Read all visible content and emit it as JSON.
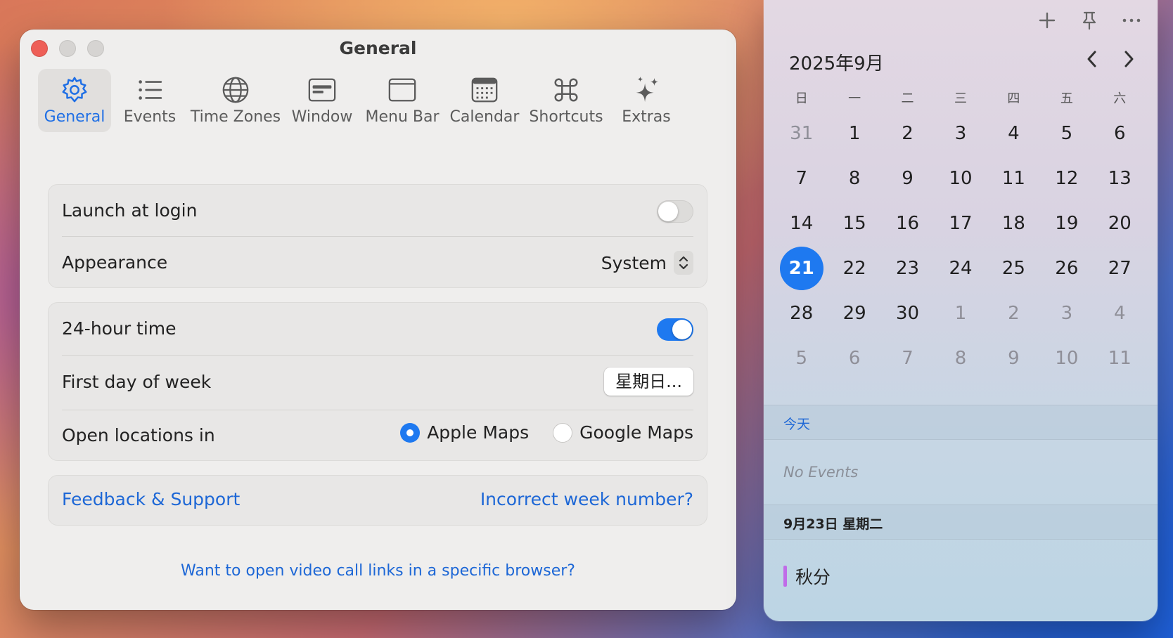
{
  "window": {
    "title": "General"
  },
  "toolbar": {
    "items": [
      {
        "label": "General",
        "icon": "gear-icon",
        "active": true
      },
      {
        "label": "Events",
        "icon": "list-icon"
      },
      {
        "label": "Time Zones",
        "icon": "globe-icon"
      },
      {
        "label": "Window",
        "icon": "window-icon"
      },
      {
        "label": "Menu Bar",
        "icon": "menu-bar-icon"
      },
      {
        "label": "Calendar",
        "icon": "calendar-icon"
      },
      {
        "label": "Shortcuts",
        "icon": "command-icon"
      },
      {
        "label": "Extras",
        "icon": "sparkles-icon"
      }
    ]
  },
  "settings": {
    "launch_at_login": {
      "label": "Launch at login",
      "enabled": false
    },
    "appearance": {
      "label": "Appearance",
      "value": "System"
    },
    "hour24": {
      "label": "24-hour time",
      "enabled": true
    },
    "first_day": {
      "label": "First day of week",
      "value": "星期日..."
    },
    "open_locations": {
      "label": "Open locations in",
      "options": [
        "Apple Maps",
        "Google Maps"
      ],
      "selected": "Apple Maps"
    }
  },
  "links": {
    "feedback": "Feedback & Support",
    "week_number": "Incorrect week number?",
    "video_browser": "Want to open video call links in a specific browser?"
  },
  "calendar": {
    "month_title": "2025年9月",
    "weekdays": [
      "日",
      "一",
      "二",
      "三",
      "四",
      "五",
      "六"
    ],
    "days": [
      {
        "d": "31",
        "muted": true
      },
      {
        "d": "1"
      },
      {
        "d": "2"
      },
      {
        "d": "3"
      },
      {
        "d": "4"
      },
      {
        "d": "5"
      },
      {
        "d": "6"
      },
      {
        "d": "7"
      },
      {
        "d": "8"
      },
      {
        "d": "9"
      },
      {
        "d": "10"
      },
      {
        "d": "11"
      },
      {
        "d": "12"
      },
      {
        "d": "13"
      },
      {
        "d": "14"
      },
      {
        "d": "15"
      },
      {
        "d": "16"
      },
      {
        "d": "17"
      },
      {
        "d": "18"
      },
      {
        "d": "19"
      },
      {
        "d": "20"
      },
      {
        "d": "21",
        "today": true
      },
      {
        "d": "22"
      },
      {
        "d": "23"
      },
      {
        "d": "24"
      },
      {
        "d": "25"
      },
      {
        "d": "26"
      },
      {
        "d": "27"
      },
      {
        "d": "28"
      },
      {
        "d": "29"
      },
      {
        "d": "30"
      },
      {
        "d": "1",
        "muted": true
      },
      {
        "d": "2",
        "muted": true
      },
      {
        "d": "3",
        "muted": true
      },
      {
        "d": "4",
        "muted": true
      },
      {
        "d": "5",
        "muted": true
      },
      {
        "d": "6",
        "muted": true
      },
      {
        "d": "7",
        "muted": true
      },
      {
        "d": "8",
        "muted": true
      },
      {
        "d": "9",
        "muted": true
      },
      {
        "d": "10",
        "muted": true
      },
      {
        "d": "11",
        "muted": true
      }
    ],
    "today_header": "今天",
    "no_events": "No Events",
    "date_header": "9月23日 星期二",
    "event": {
      "title": "秋分",
      "color": "#c06be8"
    }
  },
  "colors": {
    "accent": "#1e79f0",
    "link": "#1d67d6"
  }
}
